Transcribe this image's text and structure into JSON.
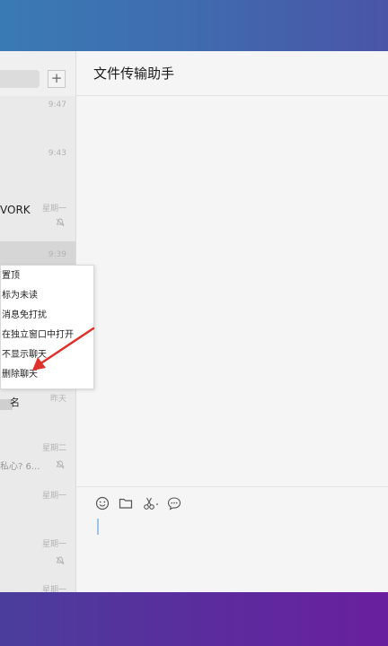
{
  "main": {
    "title": "文件传输助手"
  },
  "sidebar": {
    "add_button": "+",
    "chats": [
      {
        "time": "9:47",
        "name": "",
        "preview": "",
        "muted": false
      },
      {
        "time": "9:43",
        "name": "",
        "preview": "",
        "muted": false
      },
      {
        "time": "星期一",
        "name": "VORK",
        "preview": "",
        "muted": true
      },
      {
        "time": "9:39",
        "name": "",
        "preview": "",
        "muted": false,
        "selected": true
      },
      {
        "time": "昨天",
        "name": "名",
        "preview": "",
        "muted": false
      },
      {
        "time": "星期二",
        "name": "",
        "preview": "私心? 6...",
        "muted": true
      },
      {
        "time": "星期一",
        "name": "",
        "preview": "",
        "muted": false
      },
      {
        "time": "星期一",
        "name": "",
        "preview": "",
        "muted": true
      },
      {
        "time": "星期一",
        "name": "",
        "preview": "",
        "muted": false
      }
    ]
  },
  "context_menu": {
    "items": [
      "置顶",
      "标为未读",
      "消息免打扰",
      "在独立窗口中打开",
      "不显示聊天",
      "删除聊天"
    ]
  },
  "toolbar": {
    "icons": [
      "emoji-icon",
      "folder-icon",
      "scissors-icon",
      "chat-bubble-icon"
    ]
  },
  "colors": {
    "top_band": "#3f6db0",
    "bottom_band": "#5a2d9d",
    "arrow": "#e0302a"
  }
}
